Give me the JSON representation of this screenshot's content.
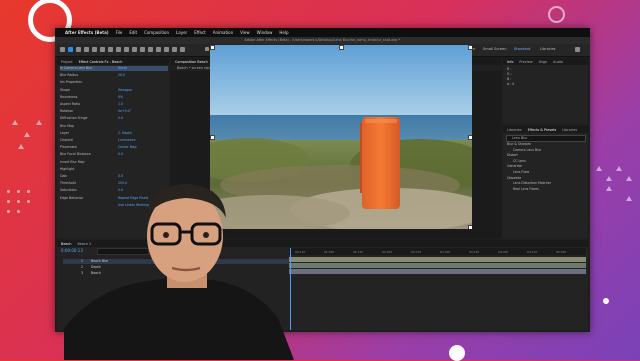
{
  "menu": {
    "apple": "",
    "app_name": "After Effects (Beta)",
    "items": [
      "File",
      "Edit",
      "Composition",
      "Layer",
      "Effect",
      "Animation",
      "View",
      "Window",
      "Help"
    ]
  },
  "window_title": "Adobe After Effects (Beta) - /Users/robert.b/Desktop/Lens Blur/ae_comp_lensblur_shot.aep *",
  "workspaces": [
    "Default",
    "Review",
    "Learn",
    "Small Screen",
    "Standard",
    "Libraries"
  ],
  "active_workspace": "Standard",
  "toolbar": {
    "snapping": "Snapping"
  },
  "effect_controls": {
    "tabs": [
      "Project",
      "Effect Controls Fx - Beach"
    ],
    "header": "Beach • 25 - Beach",
    "rows": [
      {
        "label": "fx Camera Lens Blur",
        "value": "Reset",
        "sel": true
      },
      {
        "label": "Blur Radius",
        "value": "20.0"
      },
      {
        "label": "Iris Properties",
        "value": ""
      },
      {
        "label": "Shape",
        "value": "Hexagon"
      },
      {
        "label": "Roundness",
        "value": "0%"
      },
      {
        "label": "Aspect Ratio",
        "value": "1.0"
      },
      {
        "label": "Rotation",
        "value": "0x+0.0°"
      },
      {
        "label": "Diffraction Fringe",
        "value": "0.0"
      },
      {
        "label": "Blur Map",
        "value": ""
      },
      {
        "label": "Layer",
        "value": "2. Depth"
      },
      {
        "label": "Channel",
        "value": "Luminance"
      },
      {
        "label": "Placement",
        "value": "Center Map"
      },
      {
        "label": "Blur Focal Distance",
        "value": "0.0"
      },
      {
        "label": "Invert Blur Map",
        "value": ""
      },
      {
        "label": "Highlight",
        "value": ""
      },
      {
        "label": "Gain",
        "value": "0.0"
      },
      {
        "label": "Threshold",
        "value": "255.0"
      },
      {
        "label": "Saturation",
        "value": "0.0"
      },
      {
        "label": "Edge Behavior",
        "value": "Repeat Edge Pixels"
      },
      {
        "label": "",
        "value": "Use Linear Working Space"
      }
    ]
  },
  "composition": {
    "tabs": [
      "Composition Beach",
      "Footage Beach Flattened"
    ],
    "sub": "Beach • screen replacement"
  },
  "info_panel": {
    "tabs": [
      "Info",
      "Preview",
      "Align",
      "Audio"
    ],
    "lines": [
      "R :",
      "G :",
      "B :",
      "A : 0"
    ]
  },
  "effects_panel": {
    "tabs": [
      "Libraries",
      "Effects & Presets",
      "Libraries"
    ],
    "search": "Lens Blur",
    "items": [
      "Blur & Sharpen",
      "Camera Lens Blur",
      "Distort",
      "CC Lens",
      "Generate",
      "Lens Flare",
      "Obsolete",
      "Lens Distortion Matcher",
      "Real Lens Flares"
    ]
  },
  "timeline": {
    "tabs": [
      "Beach",
      "Beach 2"
    ],
    "timecode": "0:00:00:13",
    "layers": [
      {
        "num": "1",
        "name": "Beach Blur"
      },
      {
        "num": "2",
        "name": "Depth"
      },
      {
        "num": "3",
        "name": "Beach"
      }
    ],
    "ruler": [
      "00:12f",
      "01:00f",
      "01:12f",
      "02:00f",
      "02:12f",
      "03:00f",
      "03:12f",
      "04:00f",
      "04:12f",
      "05:00f"
    ]
  },
  "colors": {
    "accent": "#2d8ceb",
    "brand_bg_start": "#e8392c",
    "brand_bg_end": "#7a42b8"
  }
}
